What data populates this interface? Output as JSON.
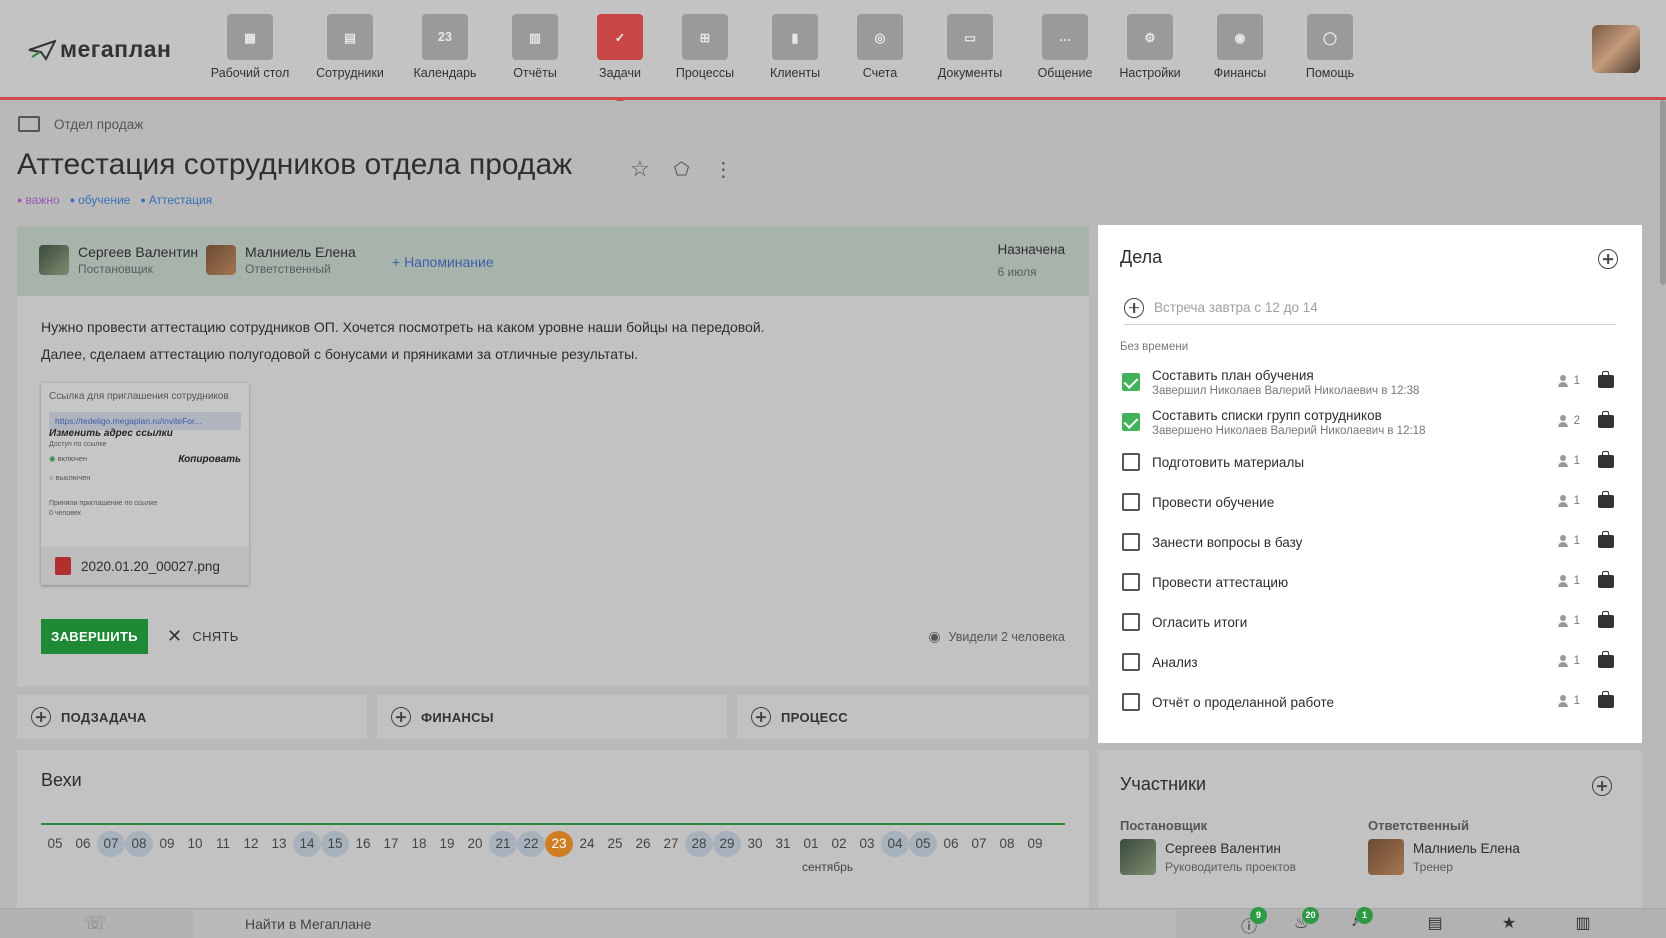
{
  "app": {
    "logo": "мегаплан"
  },
  "nav": [
    {
      "label": "Рабочий стол",
      "icon": "dashboard-icon",
      "glyph": "▦"
    },
    {
      "label": "Сотрудники",
      "icon": "employees-icon",
      "glyph": "▤"
    },
    {
      "label": "Календарь",
      "icon": "calendar-icon",
      "glyph": "23"
    },
    {
      "label": "Отчёты",
      "icon": "reports-icon",
      "glyph": "▥"
    },
    {
      "label": "Задачи",
      "icon": "tasks-icon",
      "glyph": "✓"
    },
    {
      "label": "Процессы",
      "icon": "processes-icon",
      "glyph": "⊞"
    },
    {
      "label": "Клиенты",
      "icon": "clients-icon",
      "glyph": "▮"
    },
    {
      "label": "Счета",
      "icon": "invoices-icon",
      "glyph": "◎"
    },
    {
      "label": "Документы",
      "icon": "documents-icon",
      "glyph": "▭"
    },
    {
      "label": "Общение",
      "icon": "chat-icon",
      "glyph": "…"
    },
    {
      "label": "Настройки",
      "icon": "settings-icon",
      "glyph": "⚙"
    },
    {
      "label": "Финансы",
      "icon": "finance-icon",
      "glyph": "◉"
    },
    {
      "label": "Помощь",
      "icon": "help-icon",
      "glyph": "◯"
    }
  ],
  "breadcrumb": "Отдел продаж",
  "task": {
    "title": "Аттестация сотрудников отдела продаж",
    "tags": [
      {
        "label": "важно",
        "color": "#9b59b6"
      },
      {
        "label": "обучение",
        "color": "#3a6fb8"
      },
      {
        "label": "Аттестация",
        "color": "#3a6fb8"
      }
    ],
    "owner": {
      "name": "Сергеев Валентин",
      "role": "Постановщик"
    },
    "responsible": {
      "name": "Малниель Елена",
      "role": "Ответственный"
    },
    "reminder": "+ Напоминание",
    "status": "Назначена",
    "date": "6 июля",
    "description": [
      "Нужно провести аттестацию сотрудников ОП. Хочется посмотреть на каком уровне наши бойцы на передовой.",
      "Далее, сделаем аттестацию полугодовой с бонусами и пряниками за отличные результаты."
    ],
    "attachment": {
      "preview_title": "Ссылка для приглашения сотрудников",
      "preview_url": "https://tedeligo.megaplan.ru/inviteFor...",
      "preview_note1": "Изменить адрес ссылки",
      "preview_note2": "Копировать",
      "preview_access": "Доступ по ссылке",
      "preview_on": "включен",
      "preview_off": "выключен",
      "preview_accepted": "Приняли приглашение по ссылке",
      "preview_count": "0 человек",
      "filename": "2020.01.20_00027.png"
    },
    "complete_label": "ЗАВЕРШИТЬ",
    "remove_label": "СНЯТЬ",
    "seen_label": "Увидели 2 человека"
  },
  "actions": {
    "subtask": "ПОДЗАДАЧА",
    "finance": "ФИНАНСЫ",
    "process": "ПРОЦЕСС"
  },
  "milestones": {
    "title": "Вехи",
    "days": [
      "05",
      "06",
      "07",
      "08",
      "09",
      "10",
      "11",
      "12",
      "13",
      "14",
      "15",
      "16",
      "17",
      "18",
      "19",
      "20",
      "21",
      "22",
      "23",
      "24",
      "25",
      "26",
      "27",
      "28",
      "29",
      "30",
      "31",
      "01",
      "02",
      "03",
      "04",
      "05",
      "06",
      "07",
      "08",
      "09"
    ],
    "marked": [
      2,
      3,
      9,
      10,
      16,
      17,
      23,
      24,
      30,
      31
    ],
    "today_index": 18,
    "month": "сентябрь"
  },
  "todos": {
    "title": "Дела",
    "new_placeholder": "Встреча завтра с 12 до 14",
    "group": "Без времени",
    "items": [
      {
        "title": "Составить план обучения",
        "sub": "Завершил Николаев Валерий Николаевич в 12:38",
        "count": "1",
        "done": true
      },
      {
        "title": "Составить списки групп сотрудников",
        "sub": "Завершено Николаев Валерий Николаевич в 12:18",
        "count": "2",
        "done": true
      },
      {
        "title": "Подготовить материалы",
        "sub": "",
        "count": "1",
        "done": false
      },
      {
        "title": "Провести обучение",
        "sub": "",
        "count": "1",
        "done": false
      },
      {
        "title": "Занести вопросы в базу",
        "sub": "",
        "count": "1",
        "done": false
      },
      {
        "title": "Провести аттестацию",
        "sub": "",
        "count": "1",
        "done": false
      },
      {
        "title": "Огласить итоги",
        "sub": "",
        "count": "1",
        "done": false
      },
      {
        "title": "Анализ",
        "sub": "",
        "count": "1",
        "done": false
      },
      {
        "title": "Отчёт о проделанной работе",
        "sub": "",
        "count": "1",
        "done": false
      }
    ]
  },
  "participants": {
    "title": "Участники",
    "owner_label": "Постановщик",
    "owner_name": "Сергеев Валентин",
    "owner_role": "Руководитель проектов",
    "resp_label": "Ответственный",
    "resp_name": "Малниель Елена",
    "resp_role": "Тренер"
  },
  "bottombar": {
    "search_placeholder": "Найти в Мегаплане",
    "badges": {
      "alerts": "9",
      "hot": "20",
      "notifications": "1"
    }
  }
}
